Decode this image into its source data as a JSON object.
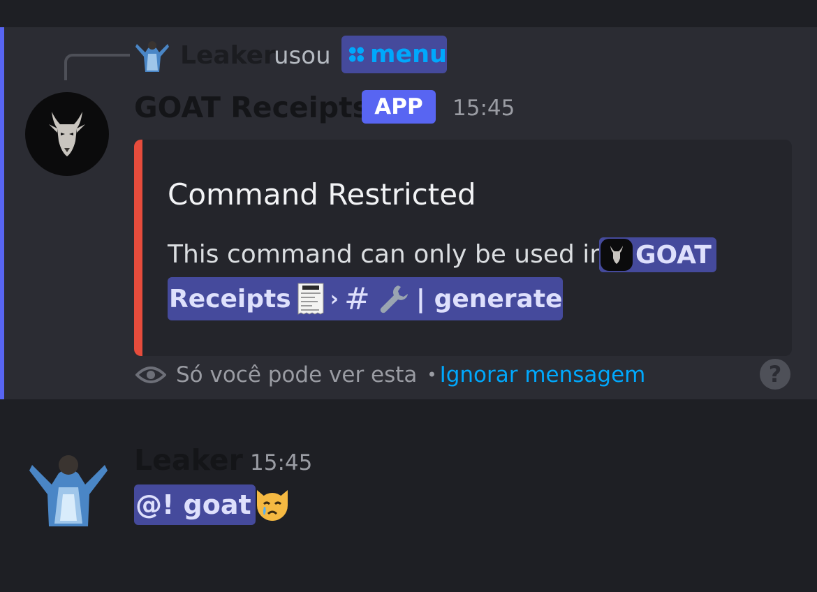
{
  "reply": {
    "author": "Leaker",
    "verb": "usou",
    "command": "menu"
  },
  "bot_message": {
    "author": "GOAT Receipts",
    "badge": "APP",
    "time": "15:45",
    "embed": {
      "accent_color": "#e64c3c",
      "title": "Command Restricted",
      "description_prefix": "This command can only be used in",
      "server_name_part1": "GOAT",
      "server_name_part2": "Receipts",
      "channel_name": "| generate"
    },
    "ephemeral_note": "Só você pode ver esta",
    "dismiss_link": "Ignorar mensagem"
  },
  "user_message": {
    "author": "Leaker",
    "time": "15:45",
    "mention": "@! goat"
  },
  "colors": {
    "mention_bg": "#454a9c",
    "link": "#00a8fc",
    "blurple": "#5865f2"
  },
  "icons": [
    "jesus-avatar-icon",
    "menu-command-icon",
    "goat-avatar-icon",
    "receipt-emoji-icon",
    "wrench-emoji-icon",
    "eye-icon",
    "help-icon",
    "crying-cat-emoji-icon"
  ]
}
